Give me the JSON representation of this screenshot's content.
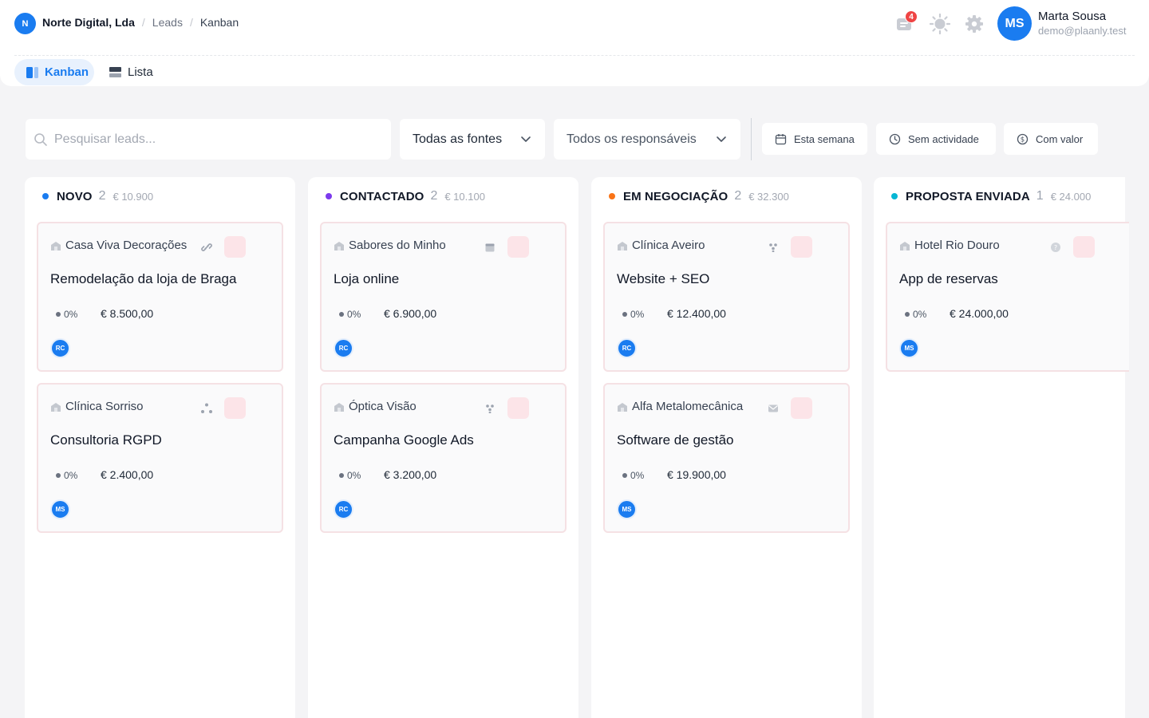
{
  "header": {
    "org_initial": "N",
    "breadcrumb": {
      "org": "Norte Digital, Lda",
      "section": "Leads",
      "current": "Kanban",
      "separator": "/"
    },
    "notifications": {
      "count": "4",
      "icon": "notifications-icon"
    },
    "theme_icon": "sun-icon",
    "settings_icon": "gear-icon",
    "user": {
      "initials": "MS",
      "name": "Marta Sousa",
      "email": "demo@plaanly.test"
    }
  },
  "view_tabs": [
    {
      "label": "Kanban",
      "icon": "kanban-icon",
      "active": true
    },
    {
      "label": "Lista",
      "icon": "list-icon",
      "active": false
    }
  ],
  "filters": {
    "search_placeholder": "Pesquisar leads...",
    "search_value": "",
    "source_select": "Todas as fontes",
    "owner_select": "Todos os responsáveis",
    "chips": [
      {
        "label": "Esta semana",
        "icon": "calendar-icon"
      },
      {
        "label": "Sem actividade",
        "icon": "clock-icon"
      },
      {
        "label": "Com valor",
        "icon": "dollar-circle-icon"
      }
    ]
  },
  "columns": [
    {
      "title": "NOVO",
      "count": "2",
      "total": "€ 10.900",
      "color": "#1a7cf0",
      "cards": [
        {
          "company": "Casa Viva Decorações",
          "status_icon": "link-icon",
          "title": "Remodelação da loja de Braga",
          "probability": "0%",
          "value": "€ 8.500,00",
          "owner": "RC"
        },
        {
          "company": "Clínica Sorriso",
          "status_icon": "share-icon",
          "title": "Consultoria RGPD",
          "probability": "0%",
          "value": "€ 2.400,00",
          "owner": "MS"
        }
      ]
    },
    {
      "title": "CONTACTADO",
      "count": "2",
      "total": "€ 10.100",
      "color": "#7c3aed",
      "cards": [
        {
          "company": "Sabores do Minho",
          "status_icon": "calendar-icon",
          "title": "Loja online",
          "probability": "0%",
          "value": "€ 6.900,00",
          "owner": "RC"
        },
        {
          "company": "Óptica Visão",
          "status_icon": "users-icon",
          "title": "Campanha Google Ads",
          "probability": "0%",
          "value": "€ 3.200,00",
          "owner": "RC"
        }
      ]
    },
    {
      "title": "EM NEGOCIAÇÃO",
      "count": "2",
      "total": "€ 32.300",
      "color": "#f97316",
      "cards": [
        {
          "company": "Clínica Aveiro",
          "status_icon": "users-icon",
          "title": "Website + SEO",
          "probability": "0%",
          "value": "€ 12.400,00",
          "owner": "RC"
        },
        {
          "company": "Alfa Metalomecânica",
          "status_icon": "mail-icon",
          "title": "Software de gestão",
          "probability": "0%",
          "value": "€ 19.900,00",
          "owner": "MS"
        }
      ]
    },
    {
      "title": "PROPOSTA ENVIADA",
      "count": "1",
      "total": "€ 24.000",
      "color": "#06b6d4",
      "cards": [
        {
          "company": "Hotel Rio Douro",
          "status_icon": "help-icon",
          "title": "App de reservas",
          "probability": "0%",
          "value": "€ 24.000,00",
          "owner": "MS"
        }
      ]
    }
  ]
}
